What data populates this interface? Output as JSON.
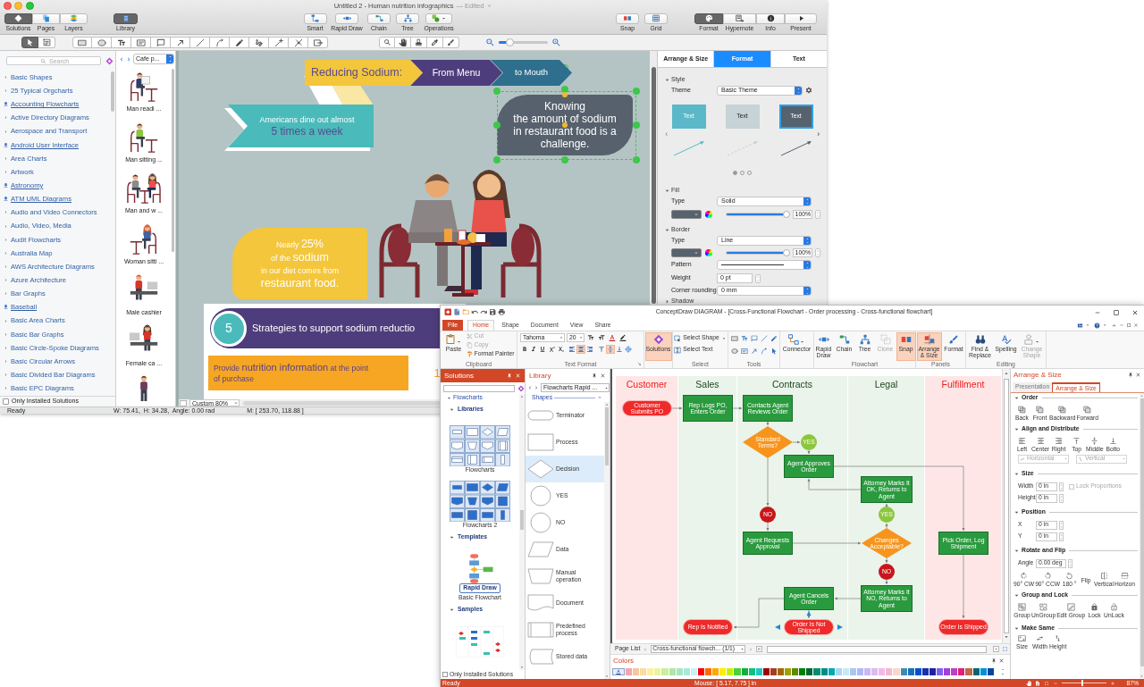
{
  "mac_window": {
    "title": "Untitled 2 - Human nutrition infographics",
    "title_status": "— Edited",
    "views": [
      {
        "label": "Solutions",
        "selected": true
      },
      {
        "label": "Pages",
        "selected": false
      },
      {
        "label": "Layers",
        "selected": false
      }
    ],
    "library_button": {
      "label": "Library",
      "selected": true
    },
    "tools": [
      "Smart",
      "Rapid Draw",
      "Chain",
      "Tree",
      "Operations"
    ],
    "helpers": [
      "Snap",
      "Grid"
    ],
    "panels": [
      {
        "label": "Format",
        "selected": true
      },
      {
        "label": "Hypernote",
        "selected": false
      },
      {
        "label": "Info",
        "selected": false
      },
      {
        "label": "Present",
        "selected": false
      }
    ],
    "mode_tools": [
      {
        "selected": true
      },
      {
        "selected": false
      }
    ],
    "zoom_slider": {
      "level": 0.22
    },
    "sidebar": {
      "search": {
        "placeholder": "Search"
      },
      "items": [
        {
          "label": "Basic Shapes",
          "kind": "folder"
        },
        {
          "label": "25 Typical Orgcharts",
          "kind": "folder"
        },
        {
          "label": "Accounting Flowcharts",
          "kind": "download"
        },
        {
          "label": "Active Directory Diagrams",
          "kind": "folder"
        },
        {
          "label": "Aerospace and Transport",
          "kind": "folder"
        },
        {
          "label": "Android User Interface",
          "kind": "download"
        },
        {
          "label": "Area Charts",
          "kind": "folder"
        },
        {
          "label": "Artwork",
          "kind": "folder"
        },
        {
          "label": "Astronomy",
          "kind": "download"
        },
        {
          "label": "ATM UML Diagrams",
          "kind": "download"
        },
        {
          "label": "Audio and Video Connectors",
          "kind": "folder"
        },
        {
          "label": "Audio, Video, Media",
          "kind": "folder"
        },
        {
          "label": "Audit Flowcharts",
          "kind": "folder"
        },
        {
          "label": "Australia Map",
          "kind": "folder"
        },
        {
          "label": "AWS Architecture Diagrams",
          "kind": "folder"
        },
        {
          "label": "Azure Architecture",
          "kind": "folder"
        },
        {
          "label": "Bar Graphs",
          "kind": "folder"
        },
        {
          "label": "Baseball",
          "kind": "download"
        },
        {
          "label": "Basic Area Charts",
          "kind": "folder"
        },
        {
          "label": "Basic Bar Graphs",
          "kind": "folder"
        },
        {
          "label": "Basic Circle-Spoke Diagrams",
          "kind": "folder"
        },
        {
          "label": "Basic Circular Arrows",
          "kind": "folder"
        },
        {
          "label": "Basic Divided Bar Diagrams",
          "kind": "folder"
        },
        {
          "label": "Basic EPC Diagrams",
          "kind": "folder"
        }
      ],
      "only_installed": {
        "label": "Only Installed Solutions",
        "checked": false
      }
    },
    "library": {
      "dropdown": "Cafe p...",
      "items": [
        {
          "label": "Man readi ...",
          "kind": "reading"
        },
        {
          "label": "Man sitting ...",
          "kind": "sitting"
        },
        {
          "label": "Man and w ...",
          "kind": "couple"
        },
        {
          "label": "Woman sitti ...",
          "kind": "woman"
        },
        {
          "label": "Male cashier",
          "kind": "cashier"
        },
        {
          "label": "Female ca ...",
          "kind": "cashier-woman"
        },
        {
          "kind": "standing"
        }
      ]
    },
    "canvas": {
      "banner": [
        "Reducing Sodium:",
        "From Menu",
        "to Mouth"
      ],
      "ribbon": "Americans dine out almost\n**5 times a week**",
      "callout": {
        "text": "Knowing\nthe amount of sodium\nin restaurant food is a\nchallenge.",
        "selected": true
      },
      "bubble": "Nearly **25%**\nof the **sodium**\nin our diet comes from\n**restaurant food.**",
      "strategy": {
        "number": "5",
        "title": "Strategies to support sodium reductio"
      },
      "step": {
        "text": "Provide **nutrition information** at the point\nof purchase",
        "number": "1"
      }
    },
    "zoom": "Custom 80%",
    "status_bar": {
      "status": "Ready",
      "dimensions": "W: 75.41,  H: 34.28,  Angle: 0.00 rad",
      "mouse": "M: [ 253.70, 118.88 ]"
    },
    "inspector": {
      "tabs": [
        {
          "label": "Arrange & Size",
          "selected": false
        },
        {
          "label": "Format",
          "selected": true
        },
        {
          "label": "Text",
          "selected": false
        }
      ],
      "style": {
        "title": "Style",
        "expanded": true,
        "theme_label": "Theme",
        "theme": "Basic Theme",
        "themes": [
          {
            "label": "Text",
            "color": "#5bb8c8",
            "kind": "solid",
            "selected": false
          },
          {
            "label": "Text",
            "color": "#c6d3d7",
            "kind": "dashed",
            "selected": false
          },
          {
            "label": "Text",
            "color": "#56626e",
            "kind": "solid",
            "selected": true
          }
        ],
        "pages": [
          {
            "selected": true
          },
          {
            "selected": false
          },
          {
            "selected": false
          }
        ]
      },
      "fill": {
        "title": "Fill",
        "expanded": true,
        "type_label": "Type",
        "type": "Solid",
        "opacity": "100%",
        "level": 1
      },
      "border": {
        "title": "Border",
        "expanded": true,
        "type_label": "Type",
        "type": "Line",
        "opacity": "100%",
        "level": 1,
        "pattern_label": "Pattern",
        "weight_label": "Weight",
        "weight": "0 pt",
        "corner_label": "Corner rounding",
        "corner": "0 mm"
      },
      "shadow": {
        "title": "Shadow",
        "expanded": false
      }
    }
  },
  "win_window": {
    "title": "ConceptDraw DIAGRAM - [Cross-Functional Flowchart - Order processing - Cross-functional flowchart]",
    "file_tab": "File",
    "tabs": [
      {
        "label": "Home",
        "selected": true
      },
      {
        "label": "Shape",
        "selected": false
      },
      {
        "label": "Document",
        "selected": false
      },
      {
        "label": "View",
        "selected": false
      },
      {
        "label": "Share",
        "selected": false
      }
    ],
    "clipboard": {
      "paste": "Paste",
      "actions": [
        {
          "label": "Cut",
          "disabled": true
        },
        {
          "label": "Copy",
          "disabled": true
        },
        {
          "label": "Format Painter",
          "disabled": false
        }
      ],
      "label": "Clipboard"
    },
    "text_format": {
      "font": "Tahoma",
      "size": "20",
      "align": [
        {
          "selected": false
        },
        {
          "selected": true
        },
        {
          "selected": false
        }
      ],
      "valign": [
        {
          "selected": false
        },
        {
          "selected": true
        },
        {
          "selected": false
        }
      ],
      "label": "Text Format"
    },
    "solutions": {
      "label": "Solutions",
      "selected": true
    },
    "select": {
      "items": [
        "Select Shape",
        "Select Text"
      ],
      "label": "Select"
    },
    "tools_label": "Tools",
    "connector": "Connector",
    "flowchart": {
      "items": [
        {
          "label": "Rapid Draw",
          "selected": false,
          "disabled": false
        },
        {
          "label": "Chain",
          "selected": false,
          "disabled": false
        },
        {
          "label": "Tree",
          "selected": false,
          "disabled": false
        },
        {
          "label": "Clone",
          "selected": false,
          "disabled": true
        },
        {
          "label": "Snap",
          "selected": true,
          "disabled": false
        }
      ],
      "label": "Flowchart"
    },
    "panels": {
      "items": [
        {
          "label": "Arrange & Size",
          "selected": true
        },
        {
          "label": "Format",
          "selected": false
        }
      ],
      "label": "Panels"
    },
    "editing": {
      "items": [
        {
          "label": "Find & Replace",
          "disabled": false
        },
        {
          "label": "Spelling",
          "disabled": false
        },
        {
          "label": "Change Shape",
          "disabled": true
        }
      ],
      "label": "Editing"
    },
    "solutions_panel": {
      "title": "Solutions",
      "category": "Flowcharts",
      "sections": [
        {
          "title": "Libraries",
          "expanded": true,
          "items": [
            {
              "label": "Flowcharts",
              "kind": "outline"
            },
            {
              "label": "Flowcharts 2",
              "kind": "filled"
            }
          ]
        },
        {
          "title": "Templates",
          "expanded": true,
          "items": [
            {
              "label": "Basic Flowchart",
              "badge": "Rapid Draw",
              "kind": "template"
            }
          ]
        },
        {
          "title": "Samples",
          "expanded": true,
          "items": [
            {
              "kind": "sample"
            }
          ]
        }
      ],
      "only_installed": {
        "label": "Only Installed Solutions",
        "checked": false
      }
    },
    "library_panel": {
      "title": "Library",
      "dropdown": "Flowcharts Rapid ...",
      "section": "Shapes",
      "shapes": [
        {
          "label": "Terminator",
          "kind": "terminator",
          "selected": false
        },
        {
          "label": "Process",
          "kind": "process",
          "selected": false
        },
        {
          "label": "Decision",
          "kind": "decision",
          "selected": true
        },
        {
          "label": "YES",
          "kind": "circle",
          "selected": false
        },
        {
          "label": "NO",
          "kind": "circle",
          "selected": false
        },
        {
          "label": "Data",
          "kind": "data",
          "selected": false
        },
        {
          "label": "Manual operation",
          "kind": "manual",
          "selected": false
        },
        {
          "label": "Document",
          "kind": "document",
          "selected": false
        },
        {
          "label": "Predefined process",
          "kind": "predefined",
          "selected": false
        },
        {
          "label": "Stored data",
          "kind": "stored",
          "selected": false
        }
      ]
    },
    "diagram": {
      "lanes": [
        {
          "title": "Customer",
          "kind": "external"
        },
        {
          "title": "Sales",
          "kind": "internal"
        },
        {
          "title": "Contracts",
          "kind": "internal"
        },
        {
          "title": "Legal",
          "kind": "internal"
        },
        {
          "title": "Fulfillment",
          "kind": "external"
        }
      ],
      "nodes": [
        {
          "kind": "terminal",
          "text": "Customer Submits PO"
        },
        {
          "kind": "process",
          "text": "Rep Logs PO, Enters Order"
        },
        {
          "kind": "process",
          "text": "Contacts Agent Reviews Order"
        },
        {
          "kind": "decision",
          "text": "Standard Terms?"
        },
        {
          "kind": "yes",
          "text": "YES"
        },
        {
          "kind": "process",
          "text": "Agent Approves Order"
        },
        {
          "kind": "process",
          "text": "Attorney Marks It OK, Returns to Agent"
        },
        {
          "kind": "yes",
          "text": "YES"
        },
        {
          "kind": "no",
          "text": "NO"
        },
        {
          "kind": "process",
          "text": "Agent Requests Approval"
        },
        {
          "kind": "decision",
          "text": "Changes Acceptable?"
        },
        {
          "kind": "process",
          "text": "Pick Order, Log Shipment"
        },
        {
          "kind": "no",
          "text": "NO"
        },
        {
          "kind": "process",
          "text": "Agent Cancels Order"
        },
        {
          "kind": "process",
          "text": "Attorney Marks It NO, Returns to Agent"
        },
        {
          "kind": "terminal",
          "text": "Rep Is Notified"
        },
        {
          "kind": "terminal",
          "text": "Order Is Not Shipped"
        },
        {
          "kind": "terminal",
          "text": "Order Is Shipped"
        }
      ]
    },
    "page_list": {
      "label": "Page List",
      "page": "Cross-functional flowch... (1/1)"
    },
    "colors": {
      "title": "Colors",
      "swatches": [
        {
          "color": "#f4a6a6"
        },
        {
          "color": "#f7c6a3"
        },
        {
          "color": "#f9dca0"
        },
        {
          "color": "#fbf0a0"
        },
        {
          "color": "#e9f5a0"
        },
        {
          "color": "#c9eea0"
        },
        {
          "color": "#b0e6a8"
        },
        {
          "color": "#a8e6c0"
        },
        {
          "color": "#a8e8dc"
        },
        {
          "color": "#c8f2f6"
        },
        {
          "color": "#ff0000"
        },
        {
          "color": "#ff6a00"
        },
        {
          "color": "#ffa800"
        },
        {
          "color": "#ffee00"
        },
        {
          "color": "#c4f000"
        },
        {
          "color": "#48d040"
        },
        {
          "color": "#10b040"
        },
        {
          "color": "#10c080"
        },
        {
          "color": "#20c8c0"
        },
        {
          "color": "#a00000"
        },
        {
          "color": "#a04020"
        },
        {
          "color": "#a06800"
        },
        {
          "color": "#a0a000"
        },
        {
          "color": "#5a8c00"
        },
        {
          "color": "#008000"
        },
        {
          "color": "#006830"
        },
        {
          "color": "#009070"
        },
        {
          "color": "#008c8c"
        },
        {
          "color": "#00a8b0"
        },
        {
          "color": "#a8d8f0"
        },
        {
          "color": "#c8e8f8"
        },
        {
          "color": "#a8c8f4"
        },
        {
          "color": "#b0b8f4"
        },
        {
          "color": "#c8b8f4"
        },
        {
          "color": "#e0b8f4"
        },
        {
          "color": "#f4b8e8"
        },
        {
          "color": "#f4b8d0"
        },
        {
          "color": "#f8d8c8"
        },
        {
          "color": "#408cb0"
        },
        {
          "color": "#1870c0"
        },
        {
          "color": "#0050d0"
        },
        {
          "color": "#1830b0"
        },
        {
          "color": "#2020a0"
        },
        {
          "color": "#8060f0"
        },
        {
          "color": "#a040e0"
        },
        {
          "color": "#c040c0"
        },
        {
          "color": "#e0207a"
        },
        {
          "color": "#c06848"
        },
        {
          "color": "#006870"
        },
        {
          "color": "#0090d8"
        },
        {
          "color": "#00489c"
        }
      ]
    },
    "arrange_panel": {
      "title": "Arrange & Size",
      "tabs": [
        {
          "label": "Presentation",
          "selected": false
        },
        {
          "label": "Arrange & Size",
          "selected": true
        }
      ],
      "sections": [
        {
          "title": "Order",
          "expanded": true,
          "buttons": [
            "Back",
            "Front",
            "Backward",
            "Forward"
          ]
        },
        {
          "title": "Align and Distribute",
          "expanded": true,
          "buttons": [
            "Left",
            "Center",
            "Right",
            "Top",
            "Middle",
            "Botto"
          ],
          "dropdowns": [
            {
              "label": "Horizontal",
              "disabled": true
            },
            {
              "label": "Vertical",
              "disabled": true
            }
          ]
        },
        {
          "title": "Size",
          "expanded": true,
          "fields": [
            {
              "label": "Width",
              "value": "0 in"
            },
            {
              "label": "Height",
              "value": "0 in"
            }
          ],
          "checkbox": {
            "label": "Lock Proportions",
            "checked": false,
            "disabled": true
          }
        },
        {
          "title": "Position",
          "expanded": true,
          "fields": [
            {
              "label": "X",
              "value": "0 in"
            },
            {
              "label": "Y",
              "value": "0 in"
            }
          ]
        },
        {
          "title": "Rotate and Flip",
          "expanded": true,
          "fields": [
            {
              "label": "Angle",
              "value": "0.00 deg"
            }
          ],
          "buttons": [
            "90° CW",
            "90° CCW",
            "180 °"
          ],
          "flip_label": "Flip",
          "flip_buttons": [
            "Vertical",
            "Horizon"
          ]
        },
        {
          "title": "Group and Lock",
          "expanded": true,
          "buttons": [
            "Group",
            "UnGroup",
            "Edit Group",
            "Lock",
            "UnLock"
          ]
        },
        {
          "title": "Make Same",
          "expanded": true,
          "buttons": [
            "Size",
            "Width",
            "Height"
          ]
        }
      ]
    },
    "status_bar": {
      "status": "Ready",
      "mouse": "Mouse: [ 5.17, 7.75 ] in",
      "zoom": "87%",
      "zoom_slider": {
        "level": 0.45
      }
    }
  }
}
